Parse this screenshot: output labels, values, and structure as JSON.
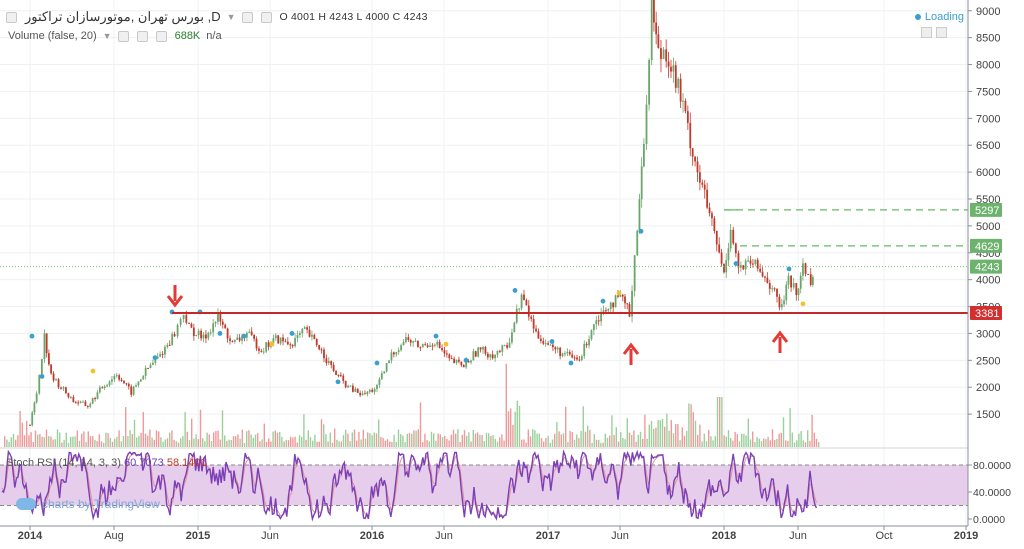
{
  "header": {
    "symbol_title": "بورس تهران ,موتورسازان تراکتور ,D",
    "ohlc": {
      "o_label": "O",
      "o": "4001",
      "h_label": "H",
      "h": "4243",
      "l_label": "L",
      "l": "4000",
      "c_label": "C",
      "c": "4243"
    },
    "volume_label": "Volume (false, 20)",
    "volume_value": "688K",
    "volume_na": "n/a",
    "loading_text": "Loading"
  },
  "price_axis": {
    "ticks": [
      "9000",
      "8500",
      "8000",
      "7500",
      "7000",
      "6500",
      "6000",
      "5500",
      "5000",
      "4500",
      "4000",
      "3500",
      "3000",
      "2500",
      "2000",
      "1500"
    ],
    "tick_values": [
      9000,
      8500,
      8000,
      7500,
      7000,
      6500,
      6000,
      5500,
      5000,
      4500,
      4000,
      3500,
      3000,
      2500,
      2000,
      1500
    ],
    "badges": [
      {
        "text": "5297",
        "value": 5297,
        "color": "#6db36d"
      },
      {
        "text": "4629",
        "value": 4629,
        "color": "#6db36d"
      },
      {
        "text": "4243",
        "value": 4243,
        "color": "#6db36d"
      },
      {
        "text": "3381",
        "value": 3381,
        "color": "#d32f2f"
      }
    ]
  },
  "stoch_axis": {
    "ticks": [
      "80.0000",
      "40.0000",
      "0.0000"
    ],
    "tick_values": [
      80,
      40,
      0
    ]
  },
  "stoch_legend": {
    "label": "Stoch RSI (14, 14, 3, 3)",
    "k_value": "60.7073",
    "d_value": "58.1401"
  },
  "time_axis": {
    "labels": [
      "2014",
      "Aug",
      "2015",
      "Jun",
      "2016",
      "Jun",
      "2017",
      "Jun",
      "2018",
      "Jun",
      "Oct",
      "2019"
    ],
    "bold": [
      true,
      false,
      true,
      false,
      true,
      false,
      true,
      false,
      true,
      false,
      false,
      true
    ]
  },
  "branding": "charts by TradingView",
  "colors": {
    "up": "#6aa56a",
    "down": "#c0392b",
    "support": "#c62828",
    "resistance_dash": "#7dc67d",
    "stoch_k": "#7b3fb8",
    "stoch_band": "#e6cdec",
    "arrow": "#e53935"
  },
  "chart_data": {
    "type": "candlestick",
    "interval": "D",
    "x_range": [
      "2014-01",
      "2019-01"
    ],
    "y_range": [
      1000,
      9200
    ],
    "y_ticks": [
      1500,
      2000,
      2500,
      3000,
      3500,
      4000,
      4500,
      5000,
      5500,
      6000,
      6500,
      7000,
      7500,
      8000,
      8500,
      9000
    ],
    "last_price": 4243,
    "horizontal_levels": [
      {
        "value": 3381,
        "style": "solid",
        "color": "#c62828"
      },
      {
        "value": 5297,
        "style": "dashed",
        "color": "#7dc67d"
      },
      {
        "value": 4629,
        "style": "dashed",
        "color": "#7dc67d"
      },
      {
        "value": 4243,
        "style": "dotted",
        "color": "#66bb6a"
      }
    ],
    "price_path": [
      {
        "x": "2014-01",
        "y": 1300
      },
      {
        "x": "2014-01-15",
        "y": 1900
      },
      {
        "x": "2014-02",
        "y": 2950
      },
      {
        "x": "2014-02-15",
        "y": 2200
      },
      {
        "x": "2014-04",
        "y": 1750
      },
      {
        "x": "2014-05",
        "y": 1650
      },
      {
        "x": "2014-06",
        "y": 2000
      },
      {
        "x": "2014-07",
        "y": 2250
      },
      {
        "x": "2014-08",
        "y": 1900
      },
      {
        "x": "2014-09",
        "y": 2300
      },
      {
        "x": "2014-10",
        "y": 2600
      },
      {
        "x": "2014-11",
        "y": 3000
      },
      {
        "x": "2014-11-20",
        "y": 3400
      },
      {
        "x": "2014-12",
        "y": 3100
      },
      {
        "x": "2015-01",
        "y": 2900
      },
      {
        "x": "2015-02",
        "y": 3300
      },
      {
        "x": "2015-03",
        "y": 2800
      },
      {
        "x": "2015-04",
        "y": 3000
      },
      {
        "x": "2015-05",
        "y": 2700
      },
      {
        "x": "2015-06",
        "y": 2900
      },
      {
        "x": "2015-07",
        "y": 2800
      },
      {
        "x": "2015-08",
        "y": 3050
      },
      {
        "x": "2015-09",
        "y": 2750
      },
      {
        "x": "2015-10",
        "y": 2300
      },
      {
        "x": "2015-11",
        "y": 2000
      },
      {
        "x": "2015-12",
        "y": 1850
      },
      {
        "x": "2016-01",
        "y": 2000
      },
      {
        "x": "2016-02",
        "y": 2600
      },
      {
        "x": "2016-03",
        "y": 2900
      },
      {
        "x": "2016-04",
        "y": 2750
      },
      {
        "x": "2016-05",
        "y": 2850
      },
      {
        "x": "2016-06",
        "y": 2500
      },
      {
        "x": "2016-07",
        "y": 2400
      },
      {
        "x": "2016-08",
        "y": 2700
      },
      {
        "x": "2016-09",
        "y": 2600
      },
      {
        "x": "2016-10",
        "y": 2750
      },
      {
        "x": "2016-11",
        "y": 3700
      },
      {
        "x": "2016-12",
        "y": 3000
      },
      {
        "x": "2017-01",
        "y": 2750
      },
      {
        "x": "2017-02",
        "y": 2600
      },
      {
        "x": "2017-03",
        "y": 2500
      },
      {
        "x": "2017-04",
        "y": 3200
      },
      {
        "x": "2017-05",
        "y": 3550
      },
      {
        "x": "2017-06",
        "y": 3650
      },
      {
        "x": "2017-06-15",
        "y": 3350
      },
      {
        "x": "2017-07",
        "y": 5000
      },
      {
        "x": "2017-07-15",
        "y": 6500
      },
      {
        "x": "2017-08",
        "y": 9200
      },
      {
        "x": "2017-08-15",
        "y": 8200
      },
      {
        "x": "2017-09",
        "y": 8300
      },
      {
        "x": "2017-10",
        "y": 7400
      },
      {
        "x": "2017-11",
        "y": 6200
      },
      {
        "x": "2017-12",
        "y": 5200
      },
      {
        "x": "2018-01",
        "y": 4100
      },
      {
        "x": "2018-01-15",
        "y": 5000
      },
      {
        "x": "2018-02",
        "y": 4200
      },
      {
        "x": "2018-03",
        "y": 4300
      },
      {
        "x": "2018-04",
        "y": 4000
      },
      {
        "x": "2018-05",
        "y": 3450
      },
      {
        "x": "2018-05-15",
        "y": 4100
      },
      {
        "x": "2018-06",
        "y": 3700
      },
      {
        "x": "2018-06-15",
        "y": 4250
      },
      {
        "x": "2018-07",
        "y": 4000
      },
      {
        "x": "2018-07-10",
        "y": 4243
      }
    ]
  }
}
